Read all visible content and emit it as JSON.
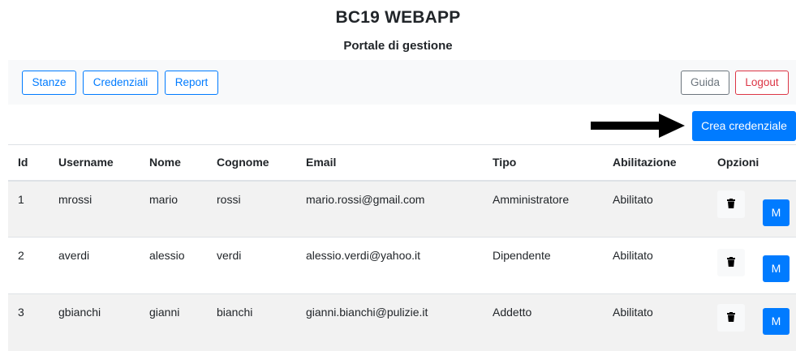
{
  "header": {
    "title": "BC19 WEBAPP",
    "subtitle": "Portale di gestione"
  },
  "nav": {
    "left": [
      "Stanze",
      "Credenziali",
      "Report"
    ],
    "guide": "Guida",
    "logout": "Logout"
  },
  "create_button": "Crea credenziale",
  "colors": {
    "primary": "#007bff",
    "danger": "#dc3545",
    "secondary": "#6c757d"
  },
  "table": {
    "columns": [
      "Id",
      "Username",
      "Nome",
      "Cognome",
      "Email",
      "Tipo",
      "Abilitazione",
      "Opzioni"
    ],
    "rows": [
      {
        "id": "1",
        "username": "mrossi",
        "nome": "mario",
        "cognome": "rossi",
        "email": "mario.rossi@gmail.com",
        "tipo": "Amministratore",
        "abilitazione": "Abilitato",
        "modify": "M"
      },
      {
        "id": "2",
        "username": "averdi",
        "nome": "alessio",
        "cognome": "verdi",
        "email": "alessio.verdi@yahoo.it",
        "tipo": "Dipendente",
        "abilitazione": "Abilitato",
        "modify": "M"
      },
      {
        "id": "3",
        "username": "gbianchi",
        "nome": "gianni",
        "cognome": "bianchi",
        "email": "gianni.bianchi@pulizie.it",
        "tipo": "Addetto",
        "abilitazione": "Abilitato",
        "modify": "M"
      }
    ]
  },
  "icons": {
    "delete": "trash-icon",
    "pointer": "arrow-right-icon"
  }
}
